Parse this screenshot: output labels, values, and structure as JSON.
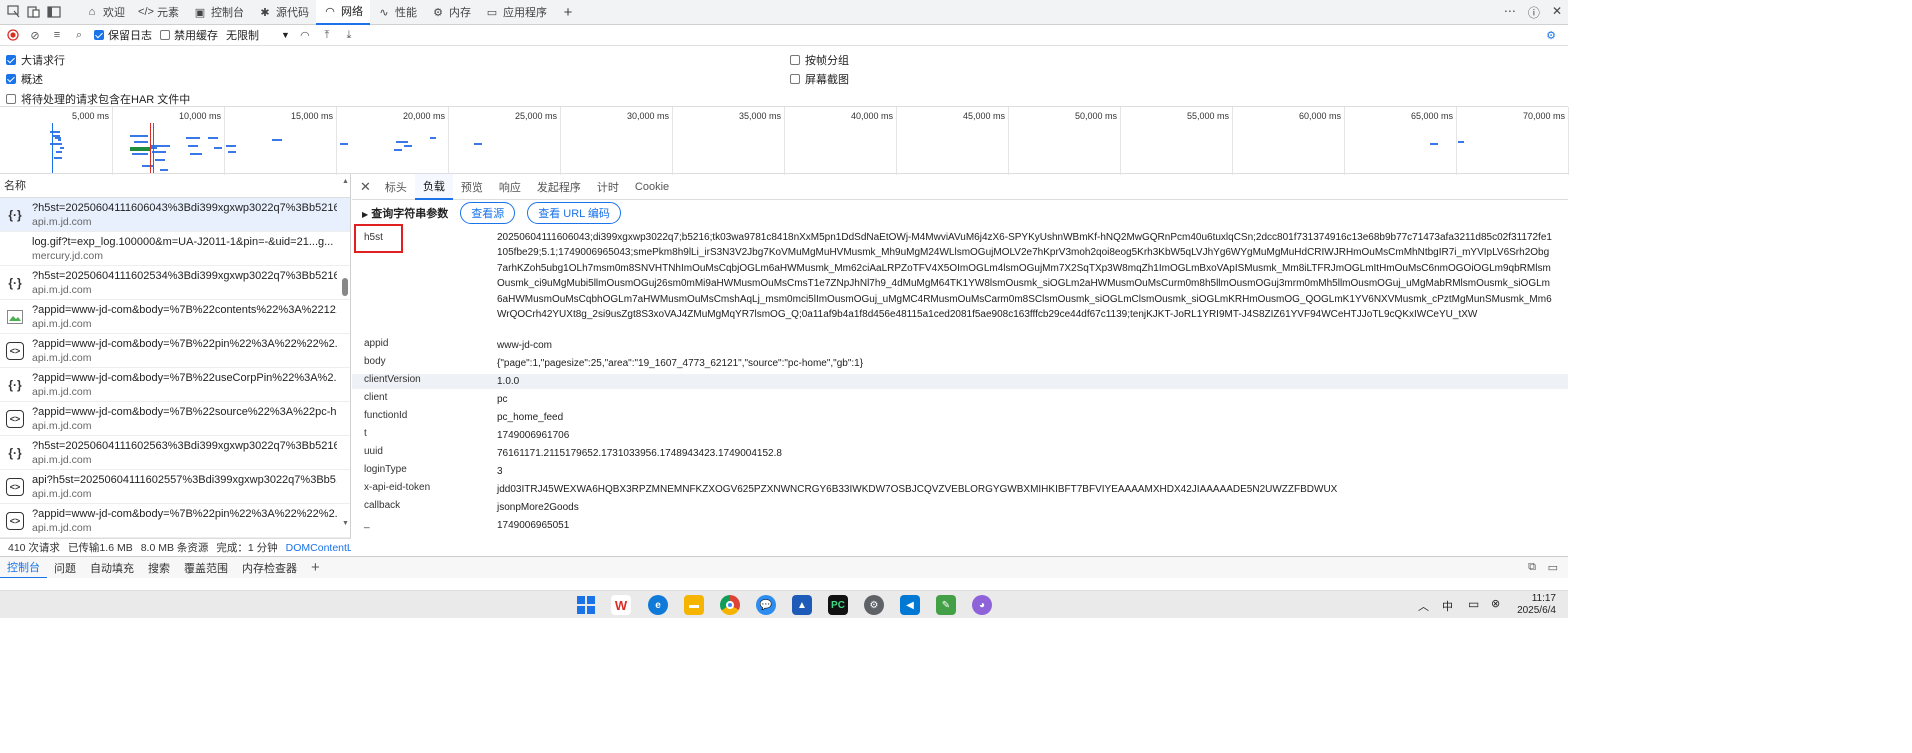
{
  "devtools": {
    "tabs": [
      "欢迎",
      "元素",
      "控制台",
      "源代码",
      "网络",
      "性能",
      "内存",
      "应用程序"
    ],
    "active_tab": "网络"
  },
  "toolbar": {
    "preserve_log": "保留日志",
    "disable_cache": "禁用缓存",
    "throttle": "无限制"
  },
  "options": {
    "large_rows": "大请求行",
    "overview": "概述",
    "har": "将待处理的请求包含在HAR 文件中",
    "group_by_frame": "按帧分组",
    "screenshots": "屏幕截图"
  },
  "timeline": {
    "ticks": [
      "5,000 ms",
      "10,000 ms",
      "15,000 ms",
      "20,000 ms",
      "25,000 ms",
      "30,000 ms",
      "35,000 ms",
      "40,000 ms",
      "45,000 ms",
      "50,000 ms",
      "55,000 ms",
      "60,000 ms",
      "65,000 ms",
      "70,000 ms"
    ]
  },
  "list": {
    "header": "名称",
    "requests": [
      {
        "name": "?h5st=20250604111606043%3Bdi399xgxwp3022q7%3Bb5216...",
        "domain": "api.m.jd.com",
        "icon": "json-icon"
      },
      {
        "name": "log.gif?t=exp_log.100000&m=UA-J2011-1&pin=-&uid=21...g...",
        "domain": "mercury.jd.com",
        "icon": "none"
      },
      {
        "name": "?h5st=20250604111602534%3Bdi399xgxwp3022q7%3Bb5216...",
        "domain": "api.m.jd.com",
        "icon": "json-icon"
      },
      {
        "name": "?appid=www-jd-com&body=%7B%22contents%22%3A%2212...",
        "domain": "api.m.jd.com",
        "icon": "image-icon"
      },
      {
        "name": "?appid=www-jd-com&body=%7B%22pin%22%3A%22%22%2...",
        "domain": "api.m.jd.com",
        "icon": "code-icon"
      },
      {
        "name": "?appid=www-jd-com&body=%7B%22useCorpPin%22%3A%2...",
        "domain": "api.m.jd.com",
        "icon": "json-icon"
      },
      {
        "name": "?appid=www-jd-com&body=%7B%22source%22%3A%22pc-h...",
        "domain": "api.m.jd.com",
        "icon": "code-icon"
      },
      {
        "name": "?h5st=20250604111602563%3Bdi399xgxwp3022q7%3Bb5216...",
        "domain": "api.m.jd.com",
        "icon": "json-icon"
      },
      {
        "name": "api?h5st=20250604111602557%3Bdi399xgxwp3022q7%3Bb5...",
        "domain": "api.m.jd.com",
        "icon": "code-icon"
      },
      {
        "name": "?appid=www-jd-com&body=%7B%22pin%22%3A%22%22%2...",
        "domain": "api.m.jd.com",
        "icon": "code-icon"
      }
    ],
    "status": {
      "requests": "410 次请求",
      "transferred": "已传输1.6 MB",
      "resources": "8.0 MB 条资源",
      "finish": "完成：1 分钟",
      "dcl": "DOMContentLo"
    }
  },
  "detail": {
    "tabs": [
      "标头",
      "负载",
      "预览",
      "响应",
      "发起程序",
      "计时",
      "Cookie"
    ],
    "active_tab": "负载",
    "section": "查询字符串参数",
    "view_source": "查看源",
    "view_url_encoded": "查看 URL 编码",
    "params": [
      {
        "k": "h5st",
        "v": "20250604111606043;di399xgxwp3022q7;b5216;tk03wa9781c8418nXxM5pn1DdSdNaEtOWj-M4MwviAVuM6j4zX6-SPYKyUshnWBmKf-hNQ2MwGQRnPcm40u6tuxlqCSn;2dcc801f731374916c13e68b9b77c71473afa3211d85c02f31172fe1105fbe29;5.1;1749006965043;smePkm8h9lLi_irS3N3V2Jbg7KoVMuMgMuHVMusmk_Mh9uMgM24WLlsmOGujMOLV2e7hKprV3moh2qoi8eog5Krh3KbW5qLVJhYg6WYgMuMgMuHdCRIWJRHmOuMsCmMhNtbgIR7i_mYVIpLV6Srh2Obg7arhKZoh5ubg1OLh7msm0m8SNVHTNhImOuMsCqbjOGLm6aHWMusmk_Mm62ciAaLRPZoTFV4X5OImOGLm4lsmOGujMm7X2SqTXp3W8mqZh1ImOGLmBxoVApISMusmk_Mm8iLTFRJmOGLmItHmOuMsC6nmOGOiOGLm9qbRMlsmOusmk_ci9uMgMubi5llmOusmOGuj26sm0mMi9aHWMusmOuMsCmsT1e7ZNpJhNl7h9_4dMuMgM64TK1YW8lsmOusmk_siOGLm2aHWMusmOuMsCurm0m8h5llmOusmOGuj3mrm0mMh5llmOusmOGuj_uMgMabRMlsmOusmk_siOGLm6aHWMusmOuMsCqbhOGLm7aHWMusmOuMsCmshAqLj_msm0mci5lImOusmOGuj_uMgMC4RMusmOuMsCarm0m8SClsmOusmk_siOGLmClsmOusmk_siOGLmKRHmOusmOG_QOGLmK1YV6NXVMusmk_cPztMgMunSMusmk_Mm6WrQOCrh42YUXt8g_2si9usZgt8S3xoVAJ4ZMuMgMqYR7lsmOG_Q;0a11af9b4a1f8d456e48115a1ced2081f5ae908c163fffcb29ce44df67c1139;tenjKJKT-JoRL1YRI9MT-J4S8ZIZ61YVF94WCeHTJJoTL9cQKxIWCeYU_tXW"
      },
      {
        "k": "appid",
        "v": "www-jd-com"
      },
      {
        "k": "body",
        "v": "{\"page\":1,\"pagesize\":25,\"area\":\"19_1607_4773_62121\",\"source\":\"pc-home\",\"gb\":1}"
      },
      {
        "k": "clientVersion",
        "v": "1.0.0"
      },
      {
        "k": "client",
        "v": "pc"
      },
      {
        "k": "functionId",
        "v": "pc_home_feed"
      },
      {
        "k": "t",
        "v": "1749006961706"
      },
      {
        "k": "uuid",
        "v": "76161171.2115179652.1731033956.1748943423.1749004152.8"
      },
      {
        "k": "loginType",
        "v": "3"
      },
      {
        "k": "x-api-eid-token",
        "v": "jdd03ITRJ45WEXWA6HQBX3RPZMNEMNFKZXOGV625PZXNWNCRGY6B33IWKDW7OSBJCQVZVEBLORGYGWBXMIHKIBFT7BFVIYEAAAAMXHDX42JIAAAAADE5N2UWZZFBDWUX"
      },
      {
        "k": "callback",
        "v": "jsonpMore2Goods"
      },
      {
        "k": "_",
        "v": "1749006965051"
      }
    ]
  },
  "drawer": {
    "tabs": [
      "控制台",
      "问题",
      "自动填充",
      "搜索",
      "覆盖范围",
      "内存检查器"
    ],
    "active": "控制台"
  },
  "taskbar": {
    "ime": "中",
    "time": "11:17",
    "date": "2025/6/4"
  },
  "colors": {
    "accent": "#1a73e8",
    "highlight": "#e02020"
  }
}
